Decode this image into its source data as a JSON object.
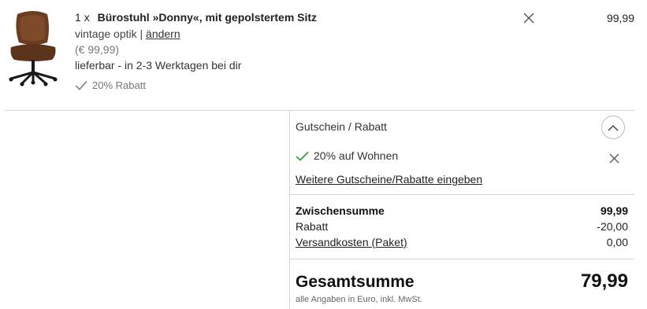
{
  "item": {
    "quantity": "1",
    "multiply": "x",
    "name": "Bürostuhl »Donny«, mit gepolstertem Sitz",
    "variant": "vintage optik",
    "separator": "|",
    "change_label": "ändern",
    "unit_price": "(€ 99,99)",
    "delivery": "lieferbar - in 2-3 Werktagen bei dir",
    "discount_label": "20% Rabatt",
    "line_price": "99,99",
    "remove_icon": "close-icon",
    "image_icon": "office-chair-image"
  },
  "coupon": {
    "title": "Gutschein / Rabatt",
    "toggle_icon": "chevron-up-icon",
    "applied_label": "20% auf Wohnen",
    "applied_icon": "checkmark-icon",
    "more_label": "Weitere Gutscheine/Rabatte eingeben"
  },
  "summary": {
    "subtotal_label": "Zwischensumme",
    "subtotal_value": "99,99",
    "discount_label": "Rabatt",
    "discount_value": "-20,00",
    "shipping_label": "Versandkosten (Paket)",
    "shipping_value": "0,00",
    "total_label": "Gesamtsumme",
    "total_value": "79,99",
    "vat_note": "alle Angaben in Euro, inkl. MwSt."
  },
  "colors": {
    "check_green": "#3a9a3a",
    "check_grey": "#8a8a8a",
    "divider": "#d4d4d4"
  }
}
